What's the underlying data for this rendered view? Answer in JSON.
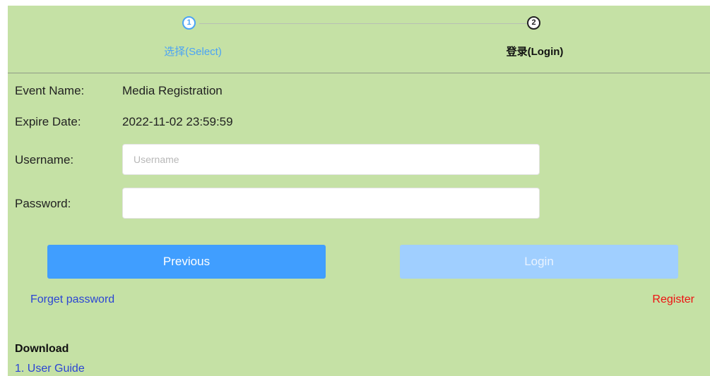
{
  "steps": [
    {
      "number": "1",
      "label": "选择(Select)"
    },
    {
      "number": "2",
      "label": "登录(Login)"
    }
  ],
  "form": {
    "event_name_label": "Event Name:",
    "event_name_value": "Media Registration",
    "expire_date_label": "Expire Date:",
    "expire_date_value": "2022-11-02 23:59:59",
    "username_label": "Username:",
    "username_placeholder": "Username",
    "username_value": "",
    "password_label": "Password:",
    "password_placeholder": "",
    "password_value": ""
  },
  "buttons": {
    "previous": "Previous",
    "login": "Login"
  },
  "links": {
    "forget_password": "Forget password",
    "register": "Register"
  },
  "download": {
    "title": "Download",
    "items": [
      "1. User Guide"
    ]
  },
  "colors": {
    "panel_bg": "#c5e1a5",
    "accent": "#409eff",
    "accent_disabled": "#a0cfff",
    "link": "#2b45d4",
    "register": "#ee1111"
  }
}
